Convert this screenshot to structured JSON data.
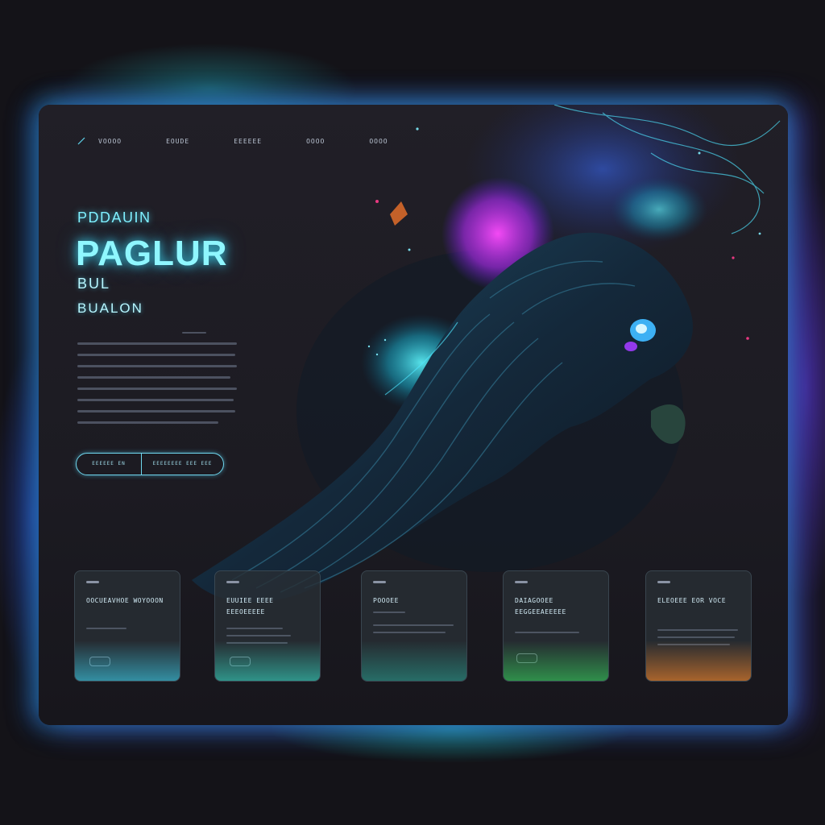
{
  "nav": {
    "items": [
      "VOOOO",
      "EOUDE",
      "EEEEEE",
      "OOOO",
      "OOOO"
    ]
  },
  "hero": {
    "eyebrow": "PDDAUIN",
    "title": "PAGLUR",
    "subtitle_1": "BUL",
    "subtitle_2": "BUALON"
  },
  "cta": {
    "left_label": "EEEEEE  EN",
    "right_label": "EEEEEEEE EEE EEE"
  },
  "cards": [
    {
      "title": "OOCUEAVHOE WOYOOON",
      "glow": "#3fe0ff"
    },
    {
      "title": "EUUIEE EEEE EEEOEEEEE",
      "glow": "#38e8d0"
    },
    {
      "title": "POOOEE",
      "glow": "#2ad0b8"
    },
    {
      "title": "DAIAGOOEE EEGGEEAEEEEE",
      "glow": "#38e060"
    },
    {
      "title": "ELEOEEE EOR VOCE",
      "glow": "#ff8a2a"
    }
  ],
  "colors": {
    "accent_cyan": "#7ff0ff",
    "accent_magenta": "#e23cff",
    "accent_violet": "#6a3cff",
    "background": "#141318"
  }
}
